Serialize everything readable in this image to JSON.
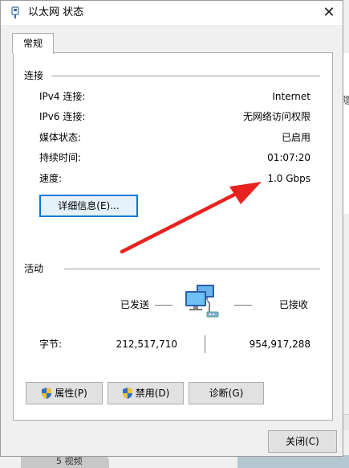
{
  "window": {
    "title": "以太网 状态"
  },
  "tabs": [
    {
      "label": "常规"
    }
  ],
  "connection": {
    "header": "连接",
    "rows": [
      {
        "label": "IPv4 连接:",
        "value": "Internet"
      },
      {
        "label": "IPv6 连接:",
        "value": "无网络访问权限"
      },
      {
        "label": "媒体状态:",
        "value": "已启用"
      },
      {
        "label": "持续时间:",
        "value": "01:07:20"
      },
      {
        "label": "速度:",
        "value": "1.0 Gbps"
      }
    ],
    "details_button": "详细信息(E)..."
  },
  "activity": {
    "header": "活动",
    "sent_label": "已发送",
    "received_label": "已接收",
    "bytes_label": "字节:",
    "bytes_sent": "212,517,710",
    "bytes_received": "954,917,288"
  },
  "buttons": {
    "properties": "属性(P)",
    "disable": "禁用(D)",
    "diagnose": "诊断(G)",
    "close": "关闭(C)"
  },
  "background": {
    "bottom_fragment": "5 视频"
  },
  "colors": {
    "annotation_arrow": "#e8231f",
    "focus_border": "#0078d7"
  }
}
